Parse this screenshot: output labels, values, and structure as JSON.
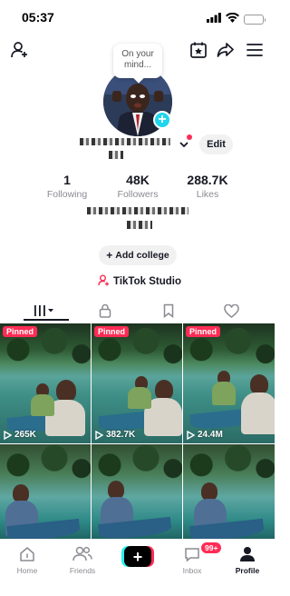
{
  "status_bar": {
    "time": "05:37"
  },
  "profile": {
    "note": "On your mind...",
    "edit_label": "Edit",
    "stats": [
      {
        "value": "1",
        "label": "Following"
      },
      {
        "value": "48K",
        "label": "Followers"
      },
      {
        "value": "288.7K",
        "label": "Likes"
      }
    ],
    "add_college_label": "Add college",
    "studio_label": "TikTok Studio"
  },
  "videos": [
    {
      "badge": "Pinned",
      "views": "265K"
    },
    {
      "badge": "Pinned",
      "views": "382.7K"
    },
    {
      "badge": "Pinned",
      "views": "24.4M"
    },
    {
      "badge": "",
      "views": ""
    },
    {
      "badge": "",
      "views": ""
    },
    {
      "badge": "",
      "views": ""
    }
  ],
  "bottom_nav": {
    "home": "Home",
    "friends": "Friends",
    "inbox": "Inbox",
    "inbox_badge": "99+",
    "profile": "Profile"
  },
  "colors": {
    "accent_red": "#fe2c55",
    "accent_cyan": "#20d5ec",
    "text": "#161823",
    "muted": "#8a8b91"
  }
}
